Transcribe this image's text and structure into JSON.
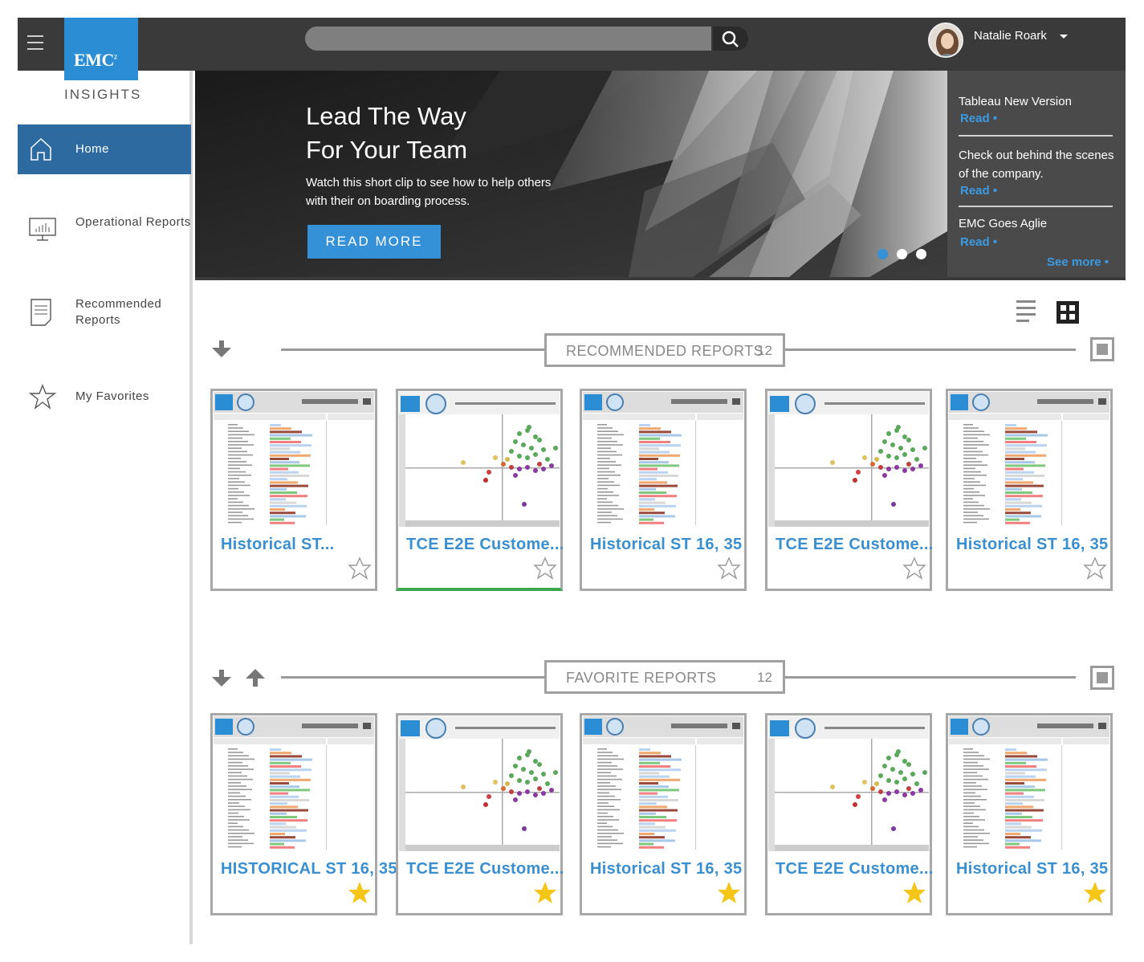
{
  "brand": {
    "logo": "EMC",
    "logo_sup": "2",
    "app_name": "INSIGHTS"
  },
  "search": {
    "placeholder": ""
  },
  "user": {
    "name": "Natalie Roark"
  },
  "nav": [
    {
      "label": "Home",
      "icon": "home-icon",
      "active": true
    },
    {
      "label": "Operational Reports",
      "icon": "monitor-chart-icon"
    },
    {
      "label": "Recommended Reports",
      "icon": "document-icon"
    },
    {
      "label": "My Favorites",
      "icon": "star-outline-icon"
    }
  ],
  "hero": {
    "title_line1": "Lead The Way",
    "title_line2": "For Your Team",
    "description": "Watch this short clip to see how to help others with their on boarding process.",
    "cta": "READ MORE",
    "slides_total": 3,
    "slide_active": 1
  },
  "news": [
    {
      "title": "Tableau New Version",
      "link": "Read •"
    },
    {
      "title": "Check out behind the scenes of the company.",
      "link": "Read •"
    },
    {
      "title": "EMC Goes Aglie",
      "link": "Read •"
    }
  ],
  "see_more": "See more •",
  "sections": {
    "recommended": {
      "title": "RECOMMENDED REPORTS",
      "count": "12",
      "cards": [
        {
          "title": "Historical ST...",
          "kind": "bars",
          "favorite": false
        },
        {
          "title": "TCE E2E Custome...",
          "kind": "scatter",
          "favorite": false,
          "active": true
        },
        {
          "title": "Historical ST 16, 35",
          "kind": "bars",
          "favorite": false
        },
        {
          "title": "TCE E2E Custome...",
          "kind": "scatter",
          "favorite": false
        },
        {
          "title": "Historical ST 16, 35",
          "kind": "bars",
          "favorite": false
        }
      ]
    },
    "favorites": {
      "title": "FAVORITE REPORTS",
      "count": "12",
      "cards": [
        {
          "title": "HISTORICAL ST 16, 35",
          "kind": "bars",
          "favorite": true
        },
        {
          "title": "TCE E2E Custome...",
          "kind": "scatter",
          "favorite": true
        },
        {
          "title": "Historical ST 16, 35",
          "kind": "bars",
          "favorite": true
        },
        {
          "title": "TCE E2E Custome...",
          "kind": "scatter",
          "favorite": true
        },
        {
          "title": "Historical ST 16, 35",
          "kind": "bars",
          "favorite": true
        }
      ]
    }
  },
  "colors": {
    "accent": "#3491d8",
    "nav_active": "#2c6aa0",
    "star_filled": "#f5c518",
    "topbar": "#3a3a3a"
  }
}
